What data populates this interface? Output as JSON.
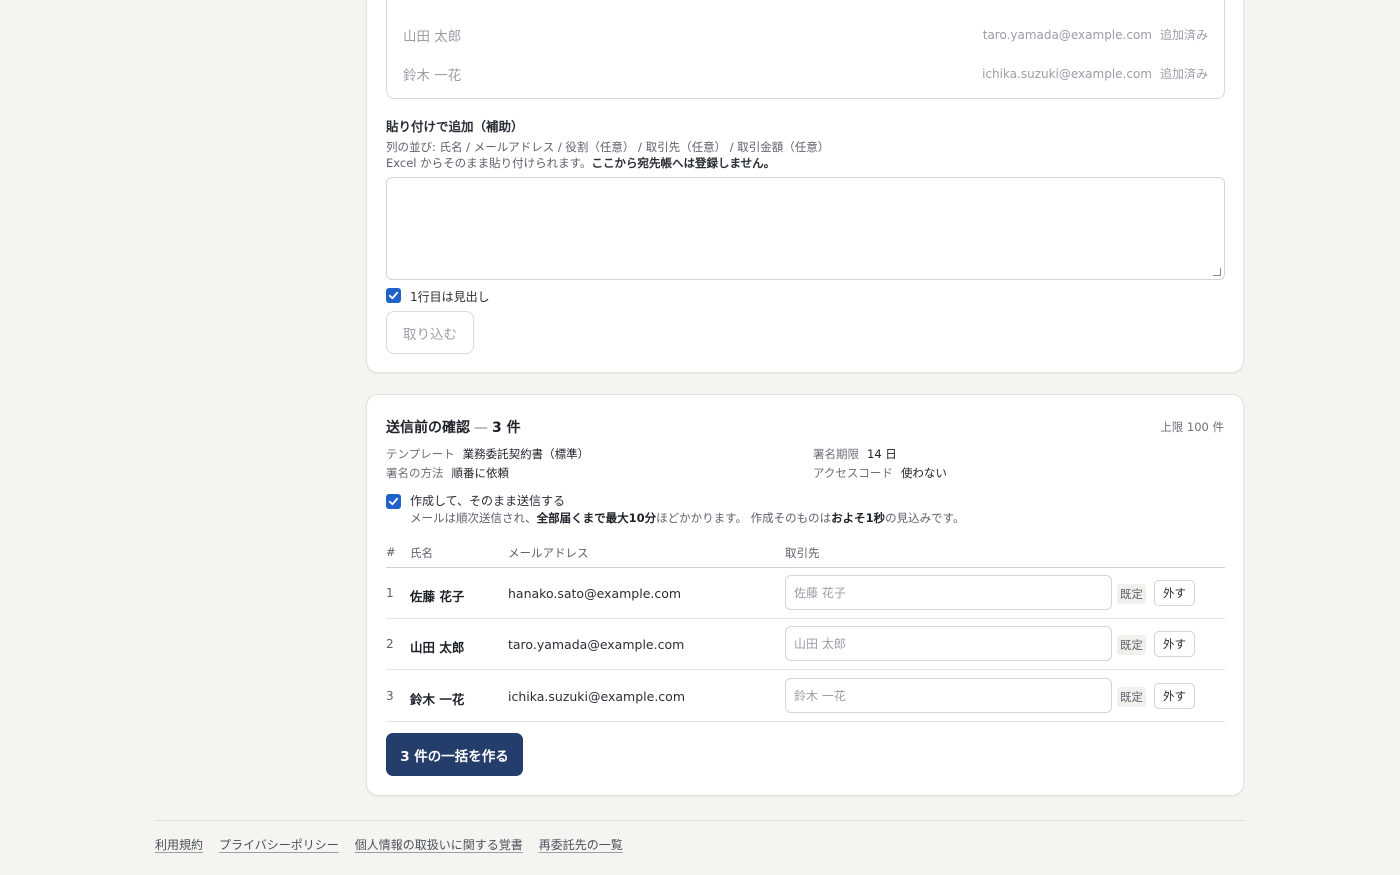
{
  "recipients_preview": [
    {
      "name": "山田 太郎",
      "email": "taro.yamada@example.com",
      "status": "追加済み"
    },
    {
      "name": "鈴木 一花",
      "email": "ichika.suzuki@example.com",
      "status": "追加済み"
    }
  ],
  "paste": {
    "title": "貼り付けで追加（補助）",
    "hint_columns": "列の並び: 氏名 / メールアドレス / 役割（任意） / 取引先（任意） / 取引金額（任意）",
    "hint_excel": "Excel からそのまま貼り付けられます。",
    "hint_excel_bold": "ここから宛先帳へは登録しません。",
    "textarea_value": "",
    "header_checkbox_label": "1行目は見出し",
    "import_button": "取り込む"
  },
  "confirm": {
    "title": "送信前の確認",
    "count_label": "3 件",
    "limit": "上限 100 件",
    "template_label": "テンプレート",
    "template_value": "業務委託契約書（標準）",
    "method_label": "署名の方法",
    "method_value": "順番に依頼",
    "deadline_label": "署名期限",
    "deadline_value": "14 日",
    "access_label": "アクセスコード",
    "access_value": "使わない",
    "send_checkbox_label": "作成して、そのまま送信する",
    "note_a": "メールは順次送信され、",
    "note_b": "全部届くまで最大10分",
    "note_c": "ほどかかります。 作成そのものは",
    "note_d": "およそ1秒",
    "note_e": "の見込みです。",
    "columns": {
      "num": "#",
      "name": "氏名",
      "email": "メールアドレス",
      "client": "取引先"
    },
    "rows": [
      {
        "num": "1",
        "name": "佐藤 花子",
        "email": "hanako.sato@example.com",
        "client_placeholder": "佐藤 花子",
        "default_label": "既定",
        "remove_label": "外す"
      },
      {
        "num": "2",
        "name": "山田 太郎",
        "email": "taro.yamada@example.com",
        "client_placeholder": "山田 太郎",
        "default_label": "既定",
        "remove_label": "外す"
      },
      {
        "num": "3",
        "name": "鈴木 一花",
        "email": "ichika.suzuki@example.com",
        "client_placeholder": "鈴木 一花",
        "default_label": "既定",
        "remove_label": "外す"
      }
    ],
    "create_button": "3 件の一括を作る"
  },
  "footer": {
    "links": [
      "利用規約",
      "プライバシーポリシー",
      "個人情報の取扱いに関する覚書",
      "再委託先の一覧"
    ]
  },
  "colors": {
    "primary": "#243d6b",
    "checkbox": "#1f62c8"
  }
}
